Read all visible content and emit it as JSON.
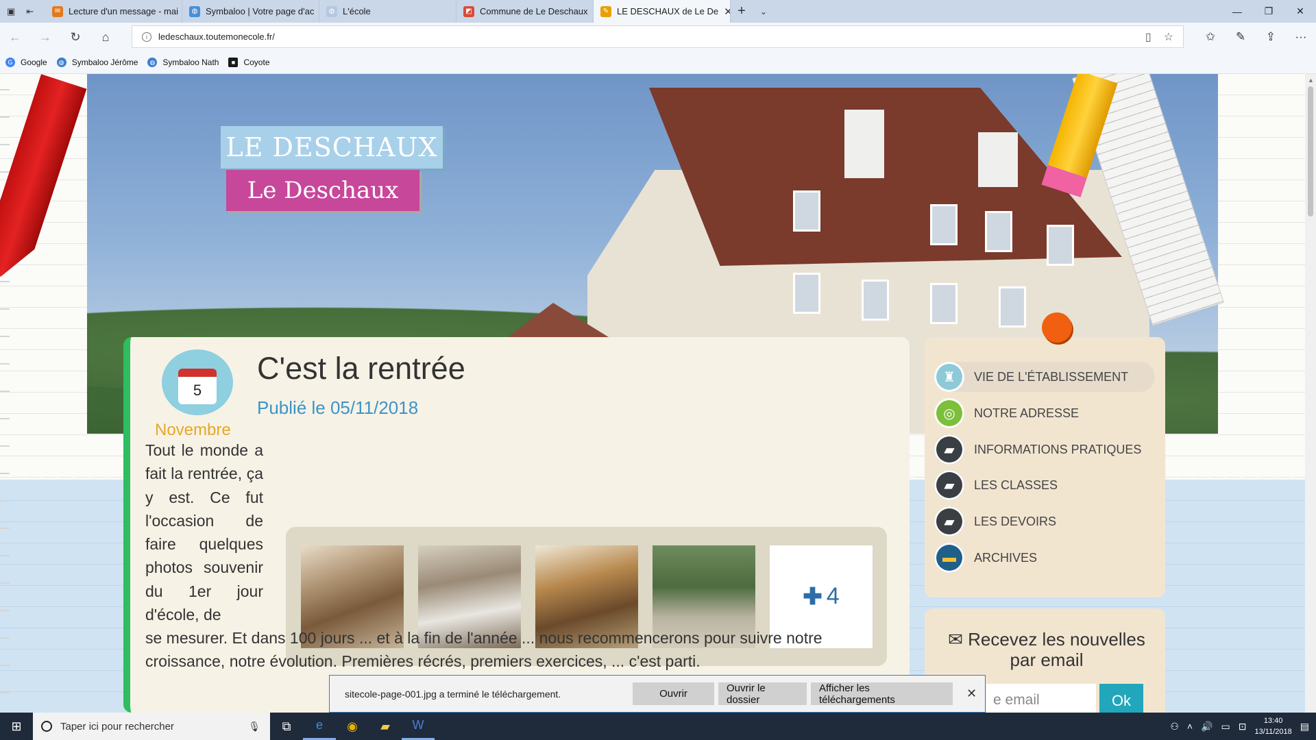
{
  "browser": {
    "tabs": [
      {
        "title": "Lecture d'un message - mai",
        "fav": "✉",
        "fav_color": "#e07a1f"
      },
      {
        "title": "Symbaloo | Votre page d'ac",
        "fav": "◍",
        "fav_color": "#4a8ed8"
      },
      {
        "title": "L'école",
        "fav": "◍",
        "fav_color": "#b5c8e0"
      },
      {
        "title": "Commune de Le Deschaux",
        "fav": "◩",
        "fav_color": "#d94a3a"
      },
      {
        "title": "LE DESCHAUX de Le De",
        "fav": "✎",
        "fav_color": "#e8a000",
        "active": true
      }
    ],
    "url": "ledeschaux.toutemonecole.fr/",
    "favorites": [
      {
        "label": "Google",
        "icon": "G",
        "color": "#4285f4"
      },
      {
        "label": "Symbaloo Jérôme",
        "icon": "◍",
        "color": "#3d7fd0"
      },
      {
        "label": "Symbaloo Nath",
        "icon": "◍",
        "color": "#3d7fd0"
      },
      {
        "label": "Coyote",
        "icon": "■",
        "color": "#1a1a1a"
      }
    ]
  },
  "site": {
    "logo_top": "LE DESCHAUX",
    "logo_bottom": "Le Deschaux",
    "post": {
      "day": "5",
      "month": "Novembre",
      "title": "C'est la rentrée",
      "date": "Publié le 05/11/2018",
      "text_narrow": "Tout le monde a fait la rentrée, ça y est. Ce fut l'occasion de faire quelques photos souvenir du 1er jour d'école, de",
      "text_full": "se mesurer. Et dans 100 jours ... et à la fin de l'année ... nous recommencerons pour suivre notre croissance, notre évolution. Premières récrés, premiers exercices, ... c'est parti.",
      "more_photos": "4"
    },
    "menu": [
      {
        "label": "VIE DE L'ÉTABLISSEMENT",
        "icon": "♜",
        "color": "#8ec9d8",
        "active": true
      },
      {
        "label": "NOTRE ADRESSE",
        "icon": "◎",
        "color": "#7bbf3a"
      },
      {
        "label": "INFORMATIONS PRATIQUES",
        "icon": "▰",
        "color": "#3a3f44"
      },
      {
        "label": "LES CLASSES",
        "icon": "▰",
        "color": "#3a3f44"
      },
      {
        "label": "LES DEVOIRS",
        "icon": "▰",
        "color": "#3a3f44"
      },
      {
        "label": "ARCHIVES",
        "icon": "▬",
        "color": "#1f5f8a"
      }
    ],
    "newsletter": {
      "title": "Recevez les nouvelles par email",
      "placeholder": "e email",
      "ok": "Ok"
    }
  },
  "download": {
    "message": "sitecole-page-001.jpg a terminé le téléchargement.",
    "open": "Ouvrir",
    "open_folder": "Ouvrir le dossier",
    "show_downloads": "Afficher les téléchargements"
  },
  "taskbar": {
    "search_placeholder": "Taper ici pour rechercher",
    "time": "13:40",
    "date": "13/11/2018"
  }
}
